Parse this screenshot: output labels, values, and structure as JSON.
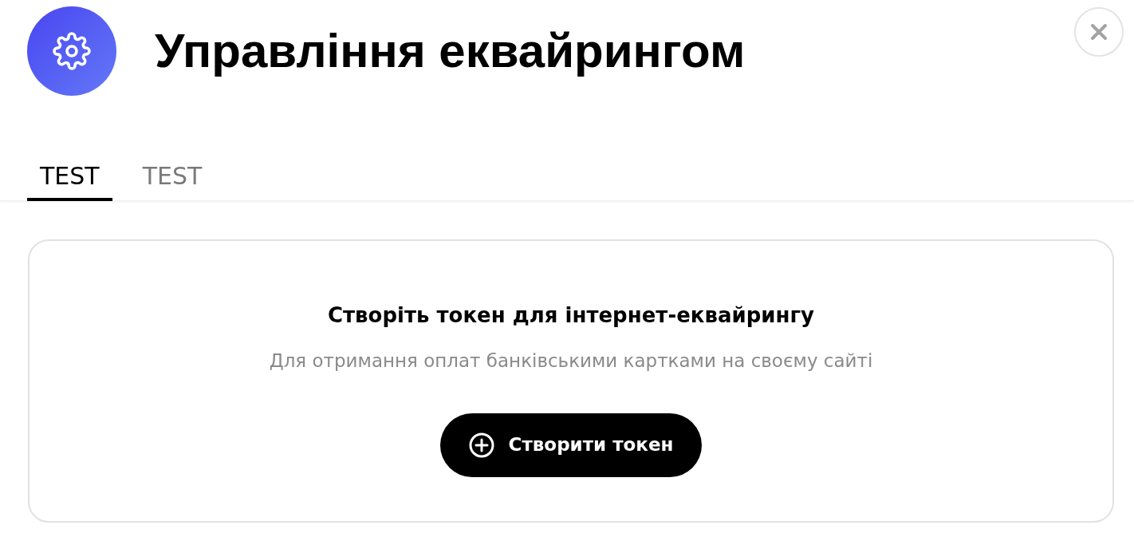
{
  "header": {
    "title": "Управління еквайрингом"
  },
  "tabs": [
    {
      "label": "TEST",
      "selected": true
    },
    {
      "label": "TEST",
      "selected": false
    }
  ],
  "card": {
    "title": "Створіть токен для інтернет-еквайрингу",
    "subtitle": "Для отримання оплат банківськими картками на своєму сайті",
    "button": "Створити токен"
  }
}
